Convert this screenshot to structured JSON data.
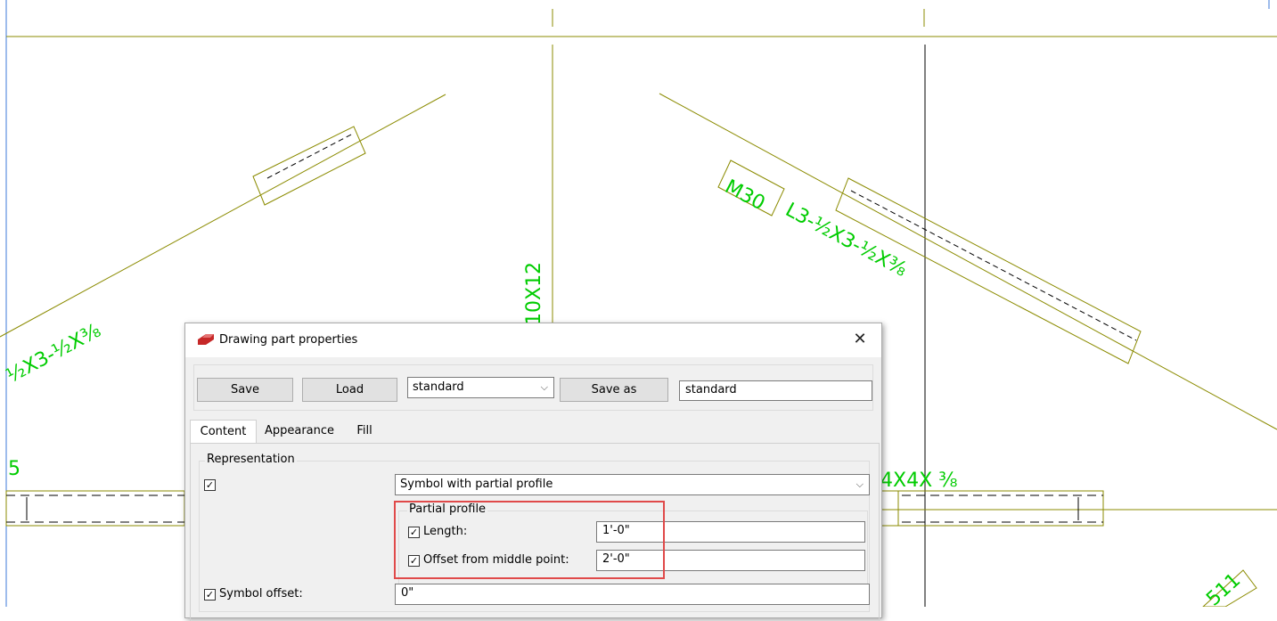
{
  "cad_labels": {
    "left_angle": "½X3-½X⅜",
    "vertical_profile": "10X12",
    "mark": "M30",
    "right_angle": "L3-½X3-½X⅜",
    "left_partial_number": "5",
    "right_beam": "4X4X ⅜",
    "bottom_right_fragment": "511"
  },
  "colors": {
    "cad_line": "#8b8b00",
    "cad_text": "#00cc00",
    "highlight": "#e04a4a"
  },
  "dialog": {
    "title": "Drawing part properties",
    "app_icon": "tekla-icon",
    "close_icon": "close-icon",
    "close_glyph": "✕",
    "toolbar": {
      "save_label": "Save",
      "load_label": "Load",
      "load_combo_value": "standard",
      "save_as_label": "Save as",
      "save_as_value": "standard"
    },
    "tabs": [
      {
        "label": "Content",
        "active": true
      },
      {
        "label": "Appearance",
        "active": false
      },
      {
        "label": "Fill",
        "active": false
      }
    ],
    "content": {
      "representation_label": "Representation",
      "representation_checked": true,
      "representation_value": "Symbol with partial profile",
      "partial_profile_label": "Partial profile",
      "length_label": "Length:",
      "length_checked": true,
      "length_value": "1'-0\"",
      "offset_label": "Offset from middle point:",
      "offset_checked": true,
      "offset_value": "2'-0\"",
      "symbol_offset_label": "Symbol offset:",
      "symbol_offset_checked": true,
      "symbol_offset_value": "0\""
    }
  }
}
